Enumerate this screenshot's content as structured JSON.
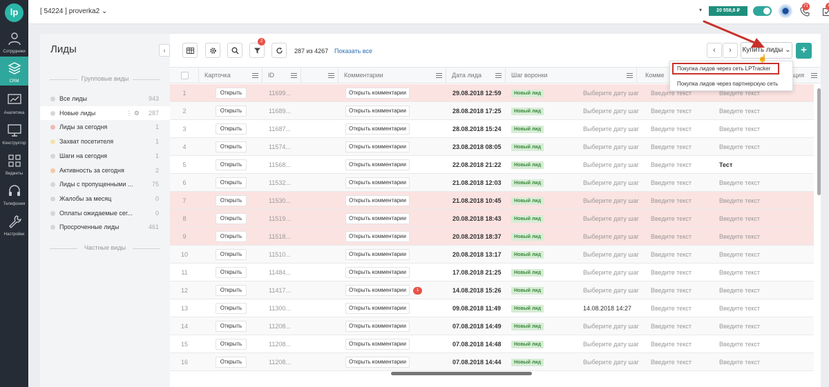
{
  "account": {
    "label": "[ 54224 ] proverka2"
  },
  "topbar": {
    "balance": "20 558,8 ₽",
    "phone_badge": "71",
    "tasks_badge": "6"
  },
  "nav": [
    {
      "label": "Сотрудники",
      "icon": "users-icon"
    },
    {
      "label": "CRM",
      "icon": "layers-icon",
      "active": true
    },
    {
      "label": "Аналитика",
      "icon": "analytics-icon"
    },
    {
      "label": "Конструктор",
      "icon": "monitor-icon"
    },
    {
      "label": "Виджеты",
      "icon": "grid-icon"
    },
    {
      "label": "Телефония",
      "icon": "headset-icon"
    },
    {
      "label": "Настройки",
      "icon": "wrench-icon"
    }
  ],
  "sidebar": {
    "title": "Лиды",
    "group_header": "Групповые виды",
    "private_header": "Частные виды",
    "views": [
      {
        "label": "Все лиды",
        "count": "943",
        "color": "#d6d6d6"
      },
      {
        "label": "Новые лиды",
        "count": "287",
        "color": "#d6d6d6",
        "selected": true
      },
      {
        "label": "Лиды за сегодня",
        "count": "1",
        "color": "#f2b8b2"
      },
      {
        "label": "Захват посетителя",
        "count": "1",
        "color": "#f3e3a8"
      },
      {
        "label": "Шаги на сегодня",
        "count": "1",
        "color": "#d6d6d6"
      },
      {
        "label": "Активность за сегодня",
        "count": "2",
        "color": "#f2c9a8"
      },
      {
        "label": "Лиды с пропущенными ...",
        "count": "75",
        "color": "#d6d6d6"
      },
      {
        "label": "Жалобы за месяц",
        "count": "0",
        "color": "#d6d6d6"
      },
      {
        "label": "Оплаты ожидаемые сег...",
        "count": "0",
        "color": "#d6d6d6"
      },
      {
        "label": "Просроченные лиды",
        "count": "461",
        "color": "#d6d6d6"
      }
    ]
  },
  "toolbar": {
    "filter_badge": "2",
    "count": "287 из 4267",
    "show_all": "Показать все",
    "buy_label": "Купить лиды",
    "add_label": "+"
  },
  "dropdown": {
    "option1": "Покупка лидов через сеть LPTracker",
    "option2": "Покупка лидов через партнерскую сеть"
  },
  "columns": {
    "card": "Карточка",
    "id": "ID",
    "comments": "Комментарии",
    "date": "Дата лида",
    "stage": "Шаг воронки",
    "comment2": "Комме",
    "action": "ация"
  },
  "rows": [
    {
      "n": "1",
      "id": "11699...",
      "date": "29.08.2018 12:59",
      "col9": "Введите текст",
      "hl": true
    },
    {
      "n": "2",
      "id": "11689...",
      "date": "28.08.2018 17:25",
      "col9": "Введите текст"
    },
    {
      "n": "3",
      "id": "11687...",
      "date": "28.08.2018 15:24",
      "col9": "Введите текст"
    },
    {
      "n": "4",
      "id": "11574...",
      "date": "23.08.2018 08:05",
      "col9": "Введите текст"
    },
    {
      "n": "5",
      "id": "11568...",
      "date": "22.08.2018 21:22",
      "col9": "Тест",
      "strong": true
    },
    {
      "n": "6",
      "id": "11532...",
      "date": "21.08.2018 12:03",
      "col9": "Введите текст"
    },
    {
      "n": "7",
      "id": "11530...",
      "date": "21.08.2018 10:45",
      "col9": "Введите текст",
      "hl": true
    },
    {
      "n": "8",
      "id": "11519...",
      "date": "20.08.2018 18:43",
      "col9": "Введите текст",
      "hl": true
    },
    {
      "n": "9",
      "id": "11518...",
      "date": "20.08.2018 18:37",
      "col9": "Введите текст",
      "hl": true
    },
    {
      "n": "10",
      "id": "11510...",
      "date": "20.08.2018 13:17",
      "col9": "Введите текст"
    },
    {
      "n": "11",
      "id": "11484...",
      "date": "17.08.2018 21:25",
      "col9": "Введите текст"
    },
    {
      "n": "12",
      "id": "11417...",
      "date": "14.08.2018 15:26",
      "col9": "Введите текст",
      "badge": "1"
    },
    {
      "n": "13",
      "id": "11300...",
      "date": "09.08.2018 11:49",
      "col9": "Введите текст",
      "step": "14.08.2018 14:27"
    },
    {
      "n": "14",
      "id": "11208...",
      "date": "07.08.2018 14:49",
      "col9": "Введите текст"
    },
    {
      "n": "15",
      "id": "11208...",
      "date": "07.08.2018 14:48",
      "col9": "Введите текст"
    },
    {
      "n": "16",
      "id": "11208...",
      "date": "07.08.2018 14:44",
      "col9": "Введите текст"
    }
  ],
  "cell_text": {
    "open": "Открыть",
    "open_comments": "Открыть комментарии",
    "stage": "Новый лид",
    "select_date": "Выберите дату шаг",
    "enter_text": "Введите текст"
  },
  "colors": {
    "accent": "#2fa79c",
    "highlight_row": "#fbe3e1",
    "badge": "#e8534a",
    "callout": "#c8312b"
  }
}
